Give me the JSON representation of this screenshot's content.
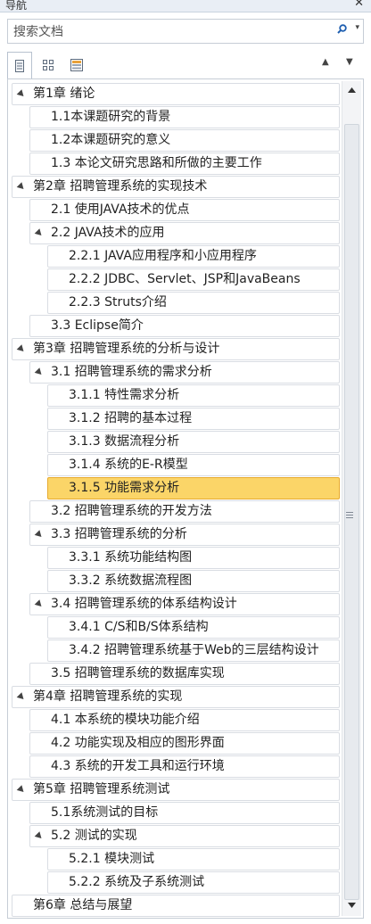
{
  "window": {
    "title": "导航",
    "close_glyph": "✕"
  },
  "search": {
    "placeholder": "搜索文档",
    "dropdown_glyph": "▾"
  },
  "tabs": [
    {
      "name": "headings",
      "icon": "document-icon"
    },
    {
      "name": "pages",
      "icon": "thumbnails-icon"
    },
    {
      "name": "results",
      "icon": "results-icon"
    }
  ],
  "nav_arrows": {
    "up": "▲",
    "down": "▼"
  },
  "outline": [
    {
      "label": "第1章  绪论",
      "level": 1,
      "expanded": true
    },
    {
      "label": "1.1本课题研究的背景",
      "level": 2
    },
    {
      "label": "1.2本课题研究的意义",
      "level": 2
    },
    {
      "label": "1.3 本论文研究思路和所做的主要工作",
      "level": 2
    },
    {
      "label": "第2章  招聘管理系统的实现技术",
      "level": 1,
      "expanded": true
    },
    {
      "label": "2.1 使用JAVA技术的优点",
      "level": 2
    },
    {
      "label": "2.2  JAVA技术的应用",
      "level": 2,
      "expanded": true
    },
    {
      "label": "2.2.1 JAVA应用程序和小应用程序",
      "level": 3
    },
    {
      "label": "2.2.2 JDBC、Servlet、JSP和JavaBeans",
      "level": 3
    },
    {
      "label": "2.2.3 Struts介绍",
      "level": 3
    },
    {
      "label": "3.3 Eclipse简介",
      "level": 2
    },
    {
      "label": "第3章  招聘管理系统的分析与设计",
      "level": 1,
      "expanded": true
    },
    {
      "label": "3.1  招聘管理系统的需求分析",
      "level": 2,
      "expanded": true
    },
    {
      "label": "3.1.1 特性需求分析",
      "level": 3
    },
    {
      "label": "3.1.2 招聘的基本过程",
      "level": 3
    },
    {
      "label": "3.1.3 数据流程分析",
      "level": 3
    },
    {
      "label": "3.1.4 系统的E-R模型",
      "level": 3
    },
    {
      "label": "3.1.5 功能需求分析",
      "level": 3,
      "selected": true
    },
    {
      "label": "3.2 招聘管理系统的开发方法",
      "level": 2
    },
    {
      "label": "3.3 招聘管理系统的分析",
      "level": 2,
      "expanded": true
    },
    {
      "label": "3.3.1 系统功能结构图",
      "level": 3
    },
    {
      "label": "3.3.2 系统数据流程图",
      "level": 3
    },
    {
      "label": "3.4 招聘管理系统的体系结构设计",
      "level": 2,
      "expanded": true
    },
    {
      "label": "3.4.1 C/S和B/S体系结构",
      "level": 3
    },
    {
      "label": "3.4.2 招聘管理系统基于Web的三层结构设计",
      "level": 3
    },
    {
      "label": "3.5 招聘管理系统的数据库实现",
      "level": 2
    },
    {
      "label": "第4章  招聘管理系统的实现",
      "level": 1,
      "expanded": true
    },
    {
      "label": "4.1 本系统的模块功能介绍",
      "level": 2
    },
    {
      "label": "4.2 功能实现及相应的图形界面",
      "level": 2
    },
    {
      "label": "4.3 系统的开发工具和运行环境",
      "level": 2
    },
    {
      "label": "第5章  招聘管理系统测试",
      "level": 1,
      "expanded": true
    },
    {
      "label": "5.1系统测试的目标",
      "level": 2
    },
    {
      "label": "5.2 测试的实现",
      "level": 2,
      "expanded": true
    },
    {
      "label": "5.2.1 模块测试",
      "level": 3
    },
    {
      "label": "5.2.2 系统及子系统测试",
      "level": 3
    },
    {
      "label": "第6章  总结与展望",
      "level": 1
    }
  ],
  "colors": {
    "selected_bg": "#fbd568",
    "selected_border": "#e7ab2f",
    "item_border": "#d9dde3",
    "search_icon": "#1f5fb0"
  }
}
